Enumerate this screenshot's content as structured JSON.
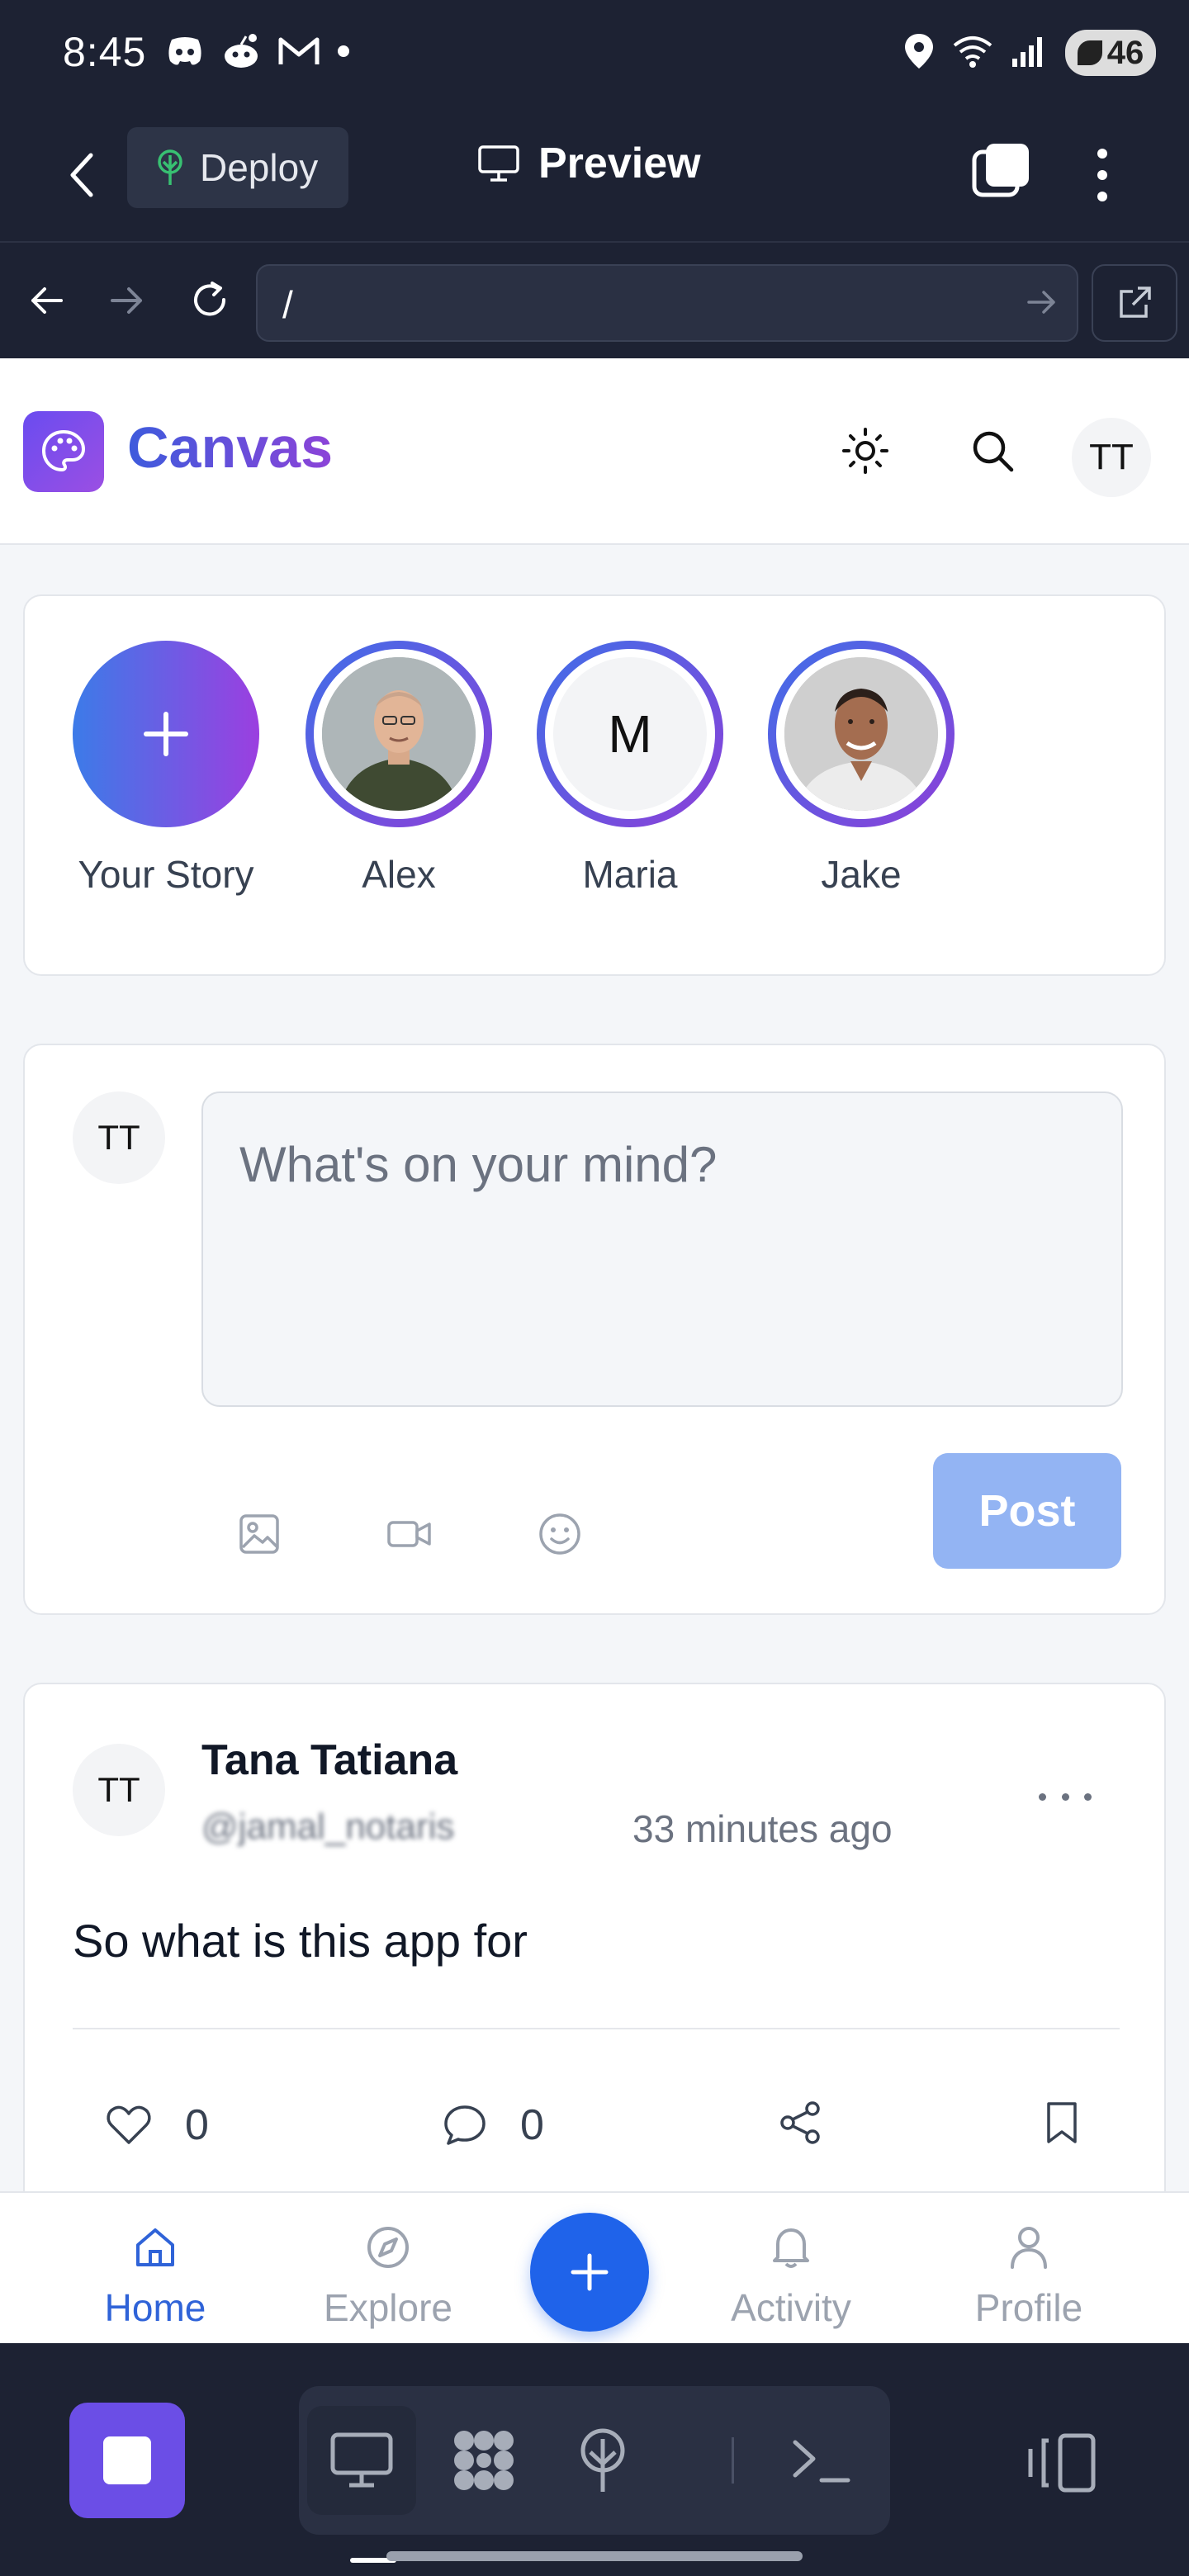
{
  "status_bar": {
    "time": "8:45",
    "battery": "46",
    "left_icons": [
      "discord-icon",
      "reddit-icon",
      "gmail-icon",
      "dot-icon"
    ],
    "right_icons": [
      "location-icon",
      "wifi-icon",
      "signal-icon",
      "battery-icon"
    ]
  },
  "app_header": {
    "deploy_label": "Deploy",
    "preview_label": "Preview"
  },
  "url_bar": {
    "value": "/"
  },
  "site": {
    "brand": "Canvas",
    "avatar_initials": "TT"
  },
  "stories": [
    {
      "label": "Your Story",
      "type": "add"
    },
    {
      "label": "Alex",
      "type": "photo"
    },
    {
      "label": "Maria",
      "type": "initial",
      "initial": "M"
    },
    {
      "label": "Jake",
      "type": "photo"
    }
  ],
  "composer": {
    "avatar_initials": "TT",
    "placeholder": "What's on your mind?",
    "post_label": "Post"
  },
  "post": {
    "avatar_initials": "TT",
    "author": "Tana Tatiana",
    "handle": "@jamal_notaris",
    "time": "33 minutes ago",
    "body": "So what is this app for",
    "likes": "0",
    "comments": "0"
  },
  "tabbar": {
    "tabs": [
      {
        "label": "Home",
        "icon": "home-icon",
        "active": true
      },
      {
        "label": "Explore",
        "icon": "compass-icon",
        "active": false
      },
      {
        "label": "Activity",
        "icon": "bell-icon",
        "active": false
      },
      {
        "label": "Profile",
        "icon": "user-icon",
        "active": false
      }
    ],
    "fab_icon": "plus-icon"
  },
  "colors": {
    "accent_blue": "#1f63ea",
    "active_tab": "#2f63d8",
    "post_button_disabled": "#93b4f3",
    "story_ring_start": "#3f6fe8",
    "story_ring_end": "#8d3fd8",
    "dark_chrome": "#1d2233"
  }
}
